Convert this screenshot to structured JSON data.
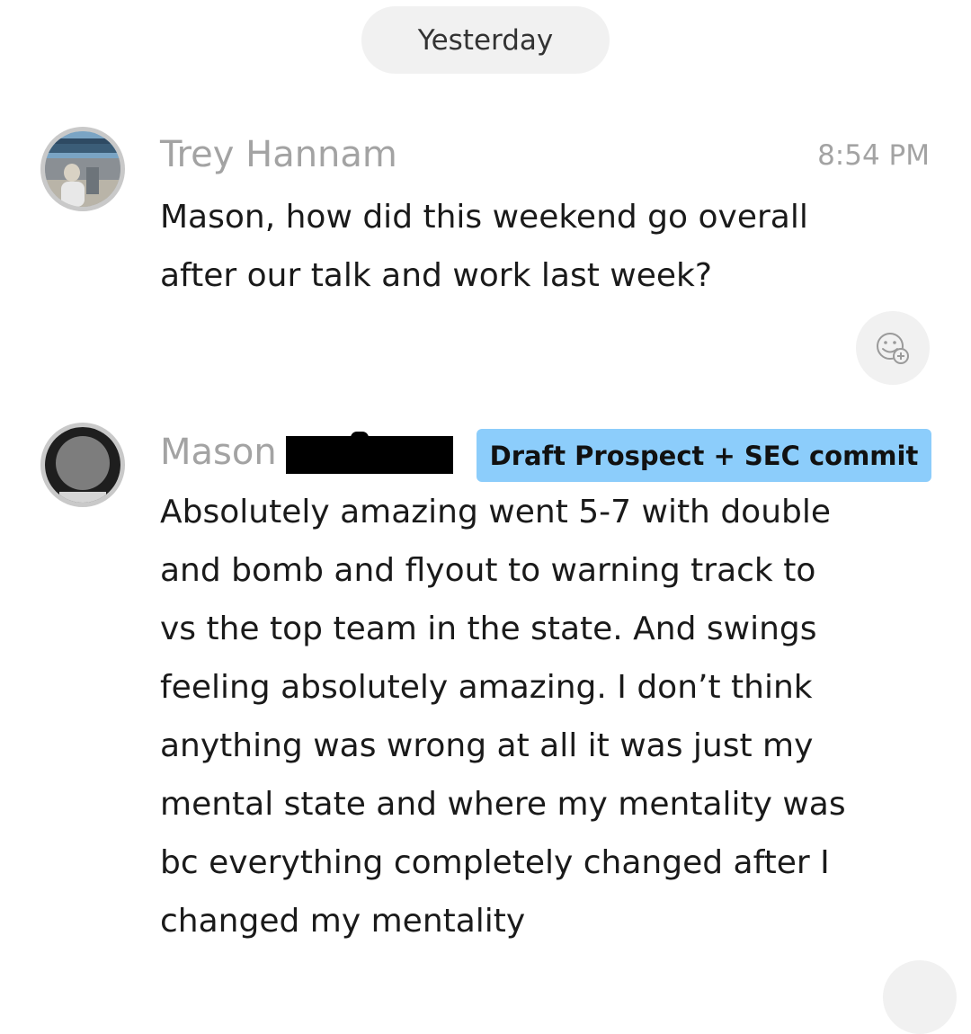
{
  "date_divider": "Yesterday",
  "messages": [
    {
      "sender": "Trey Hannam",
      "time": "8:54 PM",
      "avatar_icon": "profile-photo",
      "lines": [
        "Mason, how did this weekend go overall",
        "after our talk and work last week?"
      ],
      "reaction_icon": "add-reaction-icon"
    },
    {
      "sender": "Mason",
      "avatar_icon": "profile-photo",
      "tag": {
        "label": "Draft Prospect + SEC commit",
        "color": "#8ccdfb"
      },
      "lines": [
        "Absolutely amazing went 5-7 with double",
        "and bomb and flyout to warning track to",
        "vs the top team in the state. And swings",
        "feeling absolutely amazing. I don’t think",
        "anything was wrong at all it was just my",
        "mental state and where my mentality was",
        "bc everything completely changed after I",
        "changed my mentality"
      ]
    }
  ],
  "colors": {
    "background": "#ffffff",
    "pill_background": "#f1f1f1",
    "muted_text": "#a3a3a3",
    "body_text": "#1a1a1a",
    "redaction": "#000000"
  }
}
